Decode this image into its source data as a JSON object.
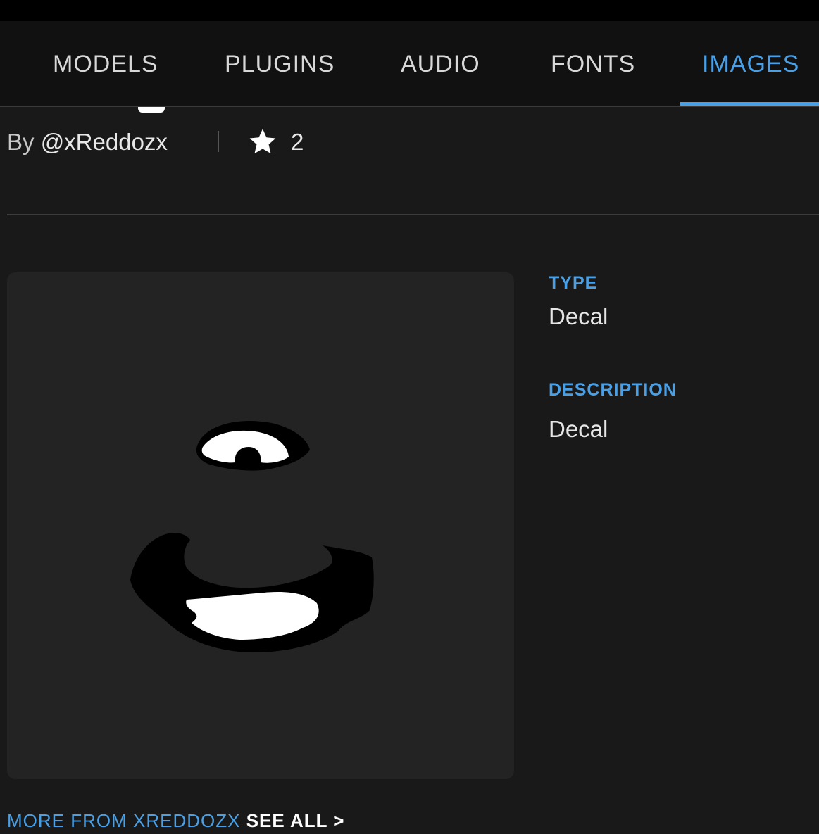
{
  "tabs": [
    {
      "label": "MODELS",
      "active": false
    },
    {
      "label": "PLUGINS",
      "active": false
    },
    {
      "label": "AUDIO",
      "active": false
    },
    {
      "label": "FONTS",
      "active": false
    },
    {
      "label": "IMAGES",
      "active": true
    }
  ],
  "asset": {
    "by_prefix": "By",
    "creator": "@xReddozx",
    "favorites": "2"
  },
  "details": {
    "type_label": "TYPE",
    "type_value": "Decal",
    "description_label": "DESCRIPTION",
    "description_value": "Decal"
  },
  "footer": {
    "more_from": "MORE FROM XREDDOZX",
    "see_all": "SEE ALL >"
  },
  "colors": {
    "accent": "#4aa0e6",
    "background": "#191919",
    "header": "#111111"
  },
  "icons": {
    "favorite": "star-icon"
  }
}
